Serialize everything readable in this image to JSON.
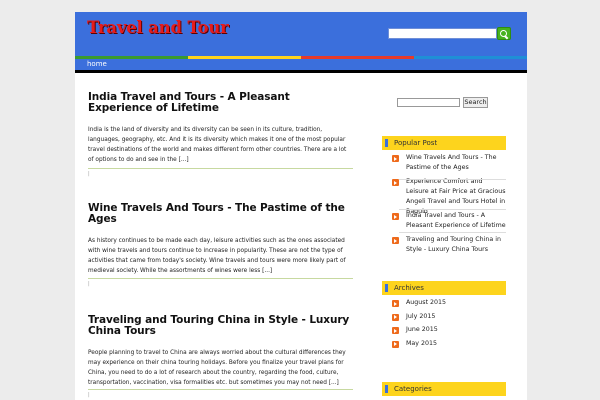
{
  "header": {
    "site_title": "Travel and Tour"
  },
  "nav": {
    "items": [
      "home"
    ]
  },
  "posts": [
    {
      "title": "India Travel and Tours - A Pleasant Experience of Lifetime",
      "excerpt": "India is the land of diversity and its diversity can be seen in its culture, tradition, languages, geography, etc. And it is its diversity which makes it one of the most popular travel destinations of the world and makes different form other countries. There are a lot of options to do and see in the [...]"
    },
    {
      "title": "Wine Travels And Tours - The Pastime of the Ages",
      "excerpt": "As history continues to be made each day, leisure activities such as the ones associated with wine travels and tours continue to increase in popularity. These are not the type of activities that came from today's society. Wine travels and tours were more likely part of medieval society. While the assortments of wines were less [...]"
    },
    {
      "title": "Traveling and Touring China in Style - Luxury China Tours",
      "excerpt": "People planning to travel to China are always worried about the cultural differences they may experience on their china touring holidays. Before you finalize your travel plans for China, you need to do a lot of research about the country, regarding the food, culture, transportation, vaccination, visa formalities etc. but sometimes you may not need [...]"
    }
  ],
  "post_separator_mark": "|",
  "sidebar": {
    "search_button": "Search",
    "popular": {
      "title": "Popular Post",
      "items": [
        "Wine Travels And Tours - The Pastime of the Ages",
        "Experience Comfort and Leisure at Fair Price at Gracious Angeli Travel and Tours Hotel in Baguio",
        "India Travel and Tours - A Pleasant Experience of Lifetime",
        "Traveling and Touring China in Style - Luxury China Tours"
      ]
    },
    "archives": {
      "title": "Archives",
      "items": [
        "August 2015",
        "July 2015",
        "June 2015",
        "May 2015"
      ]
    },
    "categories": {
      "title": "Categories"
    }
  },
  "colors": {
    "header_blue": "#3b6fdc",
    "title_red": "#e61c1c",
    "widget_yellow": "#fdd41d",
    "bullet_orange": "#ee6a1c",
    "search_green": "#46b21e"
  }
}
